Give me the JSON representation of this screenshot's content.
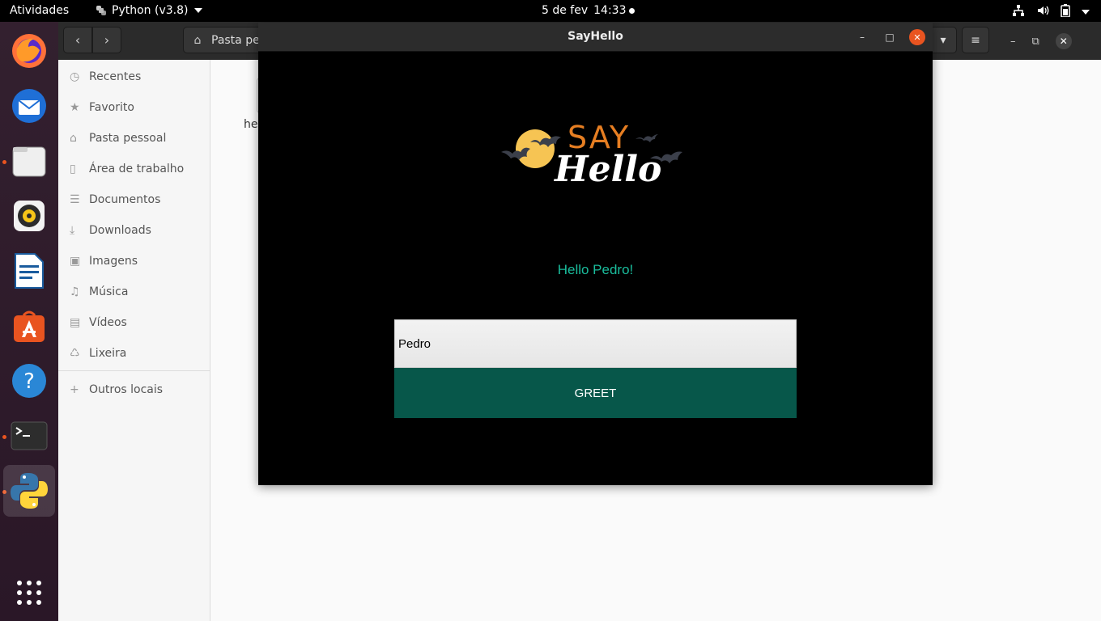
{
  "topbar": {
    "activities": "Atividades",
    "app_name": "Python (v3.8)",
    "date": "5 de fev",
    "time": "14:33"
  },
  "dock": {
    "items": [
      {
        "name": "firefox-icon"
      },
      {
        "name": "thunderbird-icon"
      },
      {
        "name": "files-icon"
      },
      {
        "name": "rhythmbox-icon"
      },
      {
        "name": "writer-icon"
      },
      {
        "name": "software-icon"
      },
      {
        "name": "help-icon"
      },
      {
        "name": "terminal-icon"
      },
      {
        "name": "python-icon"
      },
      {
        "name": "show-apps-icon"
      }
    ]
  },
  "files": {
    "path": "Pasta pe",
    "sidebar": [
      {
        "label": "Recentes",
        "icon": "clock-icon"
      },
      {
        "label": "Favorito",
        "icon": "star-icon"
      },
      {
        "label": "Pasta pessoal",
        "icon": "home-icon"
      },
      {
        "label": "Área de trabalho",
        "icon": "desktop-icon"
      },
      {
        "label": "Documentos",
        "icon": "document-icon"
      },
      {
        "label": "Downloads",
        "icon": "download-icon"
      },
      {
        "label": "Imagens",
        "icon": "image-icon"
      },
      {
        "label": "Música",
        "icon": "music-icon"
      },
      {
        "label": "Vídeos",
        "icon": "video-icon"
      },
      {
        "label": "Lixeira",
        "icon": "trash-icon"
      }
    ],
    "other_locations": "Outros locais",
    "file_label": "hel"
  },
  "sayhello": {
    "window_title": "SayHello",
    "logo_say": "SAY",
    "logo_hello": "Hello",
    "greeting": "Hello Pedro!",
    "input_value": "Pedro",
    "button_label": "GREET"
  },
  "colors": {
    "accent": "#e95420",
    "greeting": "#1abc9c",
    "button": "#07574a",
    "logo_orange": "#e67e22"
  }
}
